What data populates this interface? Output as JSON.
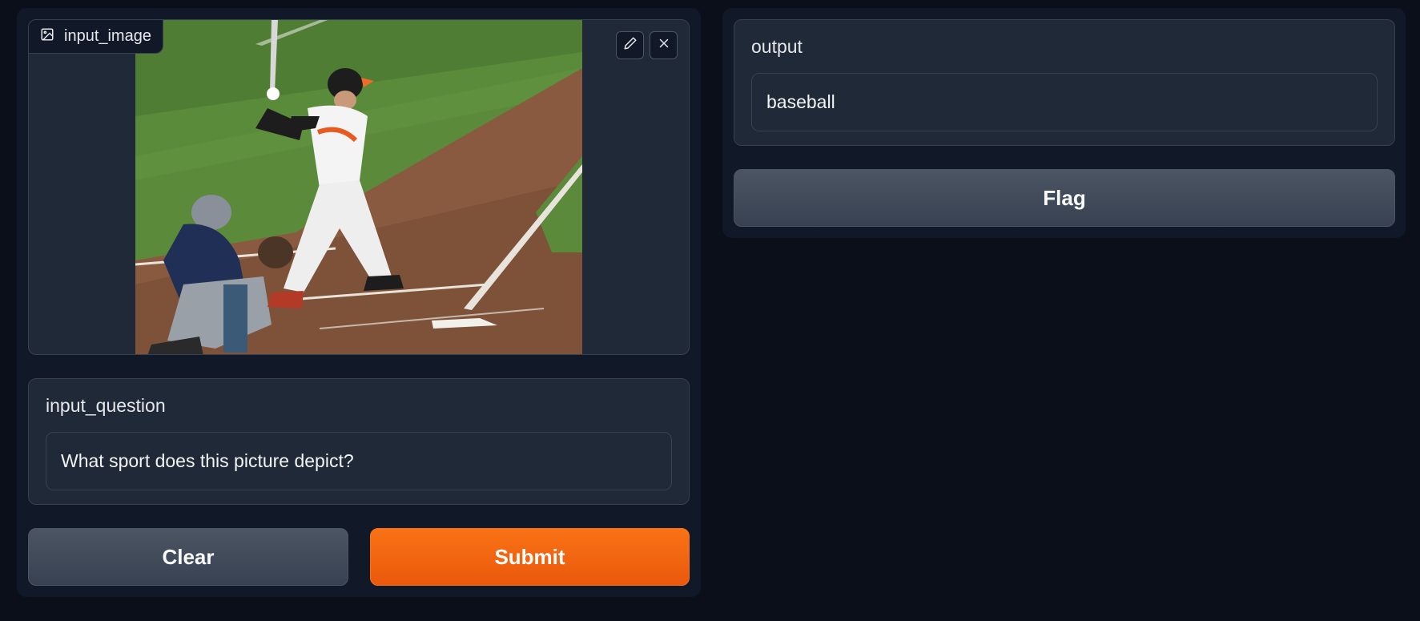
{
  "input_image": {
    "label": "input_image",
    "label_icon": "image-icon",
    "edit_icon": "pencil-icon",
    "close_icon": "close-icon"
  },
  "input_question": {
    "label": "input_question",
    "value": "What sport does this picture depict?"
  },
  "buttons": {
    "clear": "Clear",
    "submit": "Submit",
    "flag": "Flag"
  },
  "output": {
    "label": "output",
    "value": "baseball"
  },
  "colors": {
    "accent": "#f97316",
    "background": "#0b0f19",
    "panel": "#111827",
    "block": "#1f2937"
  }
}
